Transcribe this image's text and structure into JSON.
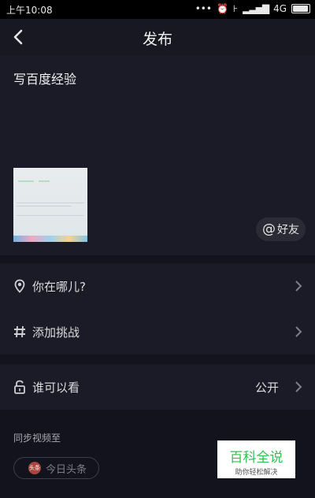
{
  "statusbar": {
    "time": "上午10:08",
    "network": "4G",
    "battery_level": 0.95
  },
  "header": {
    "title": "发布"
  },
  "compose": {
    "text": "写百度经验",
    "friend_button": "好友",
    "at_symbol": "@"
  },
  "rows": {
    "location": "你在哪儿?",
    "challenge": "添加挑战",
    "visibility_label": "谁可以看",
    "visibility_value": "公开"
  },
  "sync": {
    "label": "同步视频至",
    "toutiao": "今日头条",
    "toutiao_icon_text": "头条"
  },
  "watermark": {
    "title": "百科全说",
    "subtitle": "助你轻松解决"
  }
}
